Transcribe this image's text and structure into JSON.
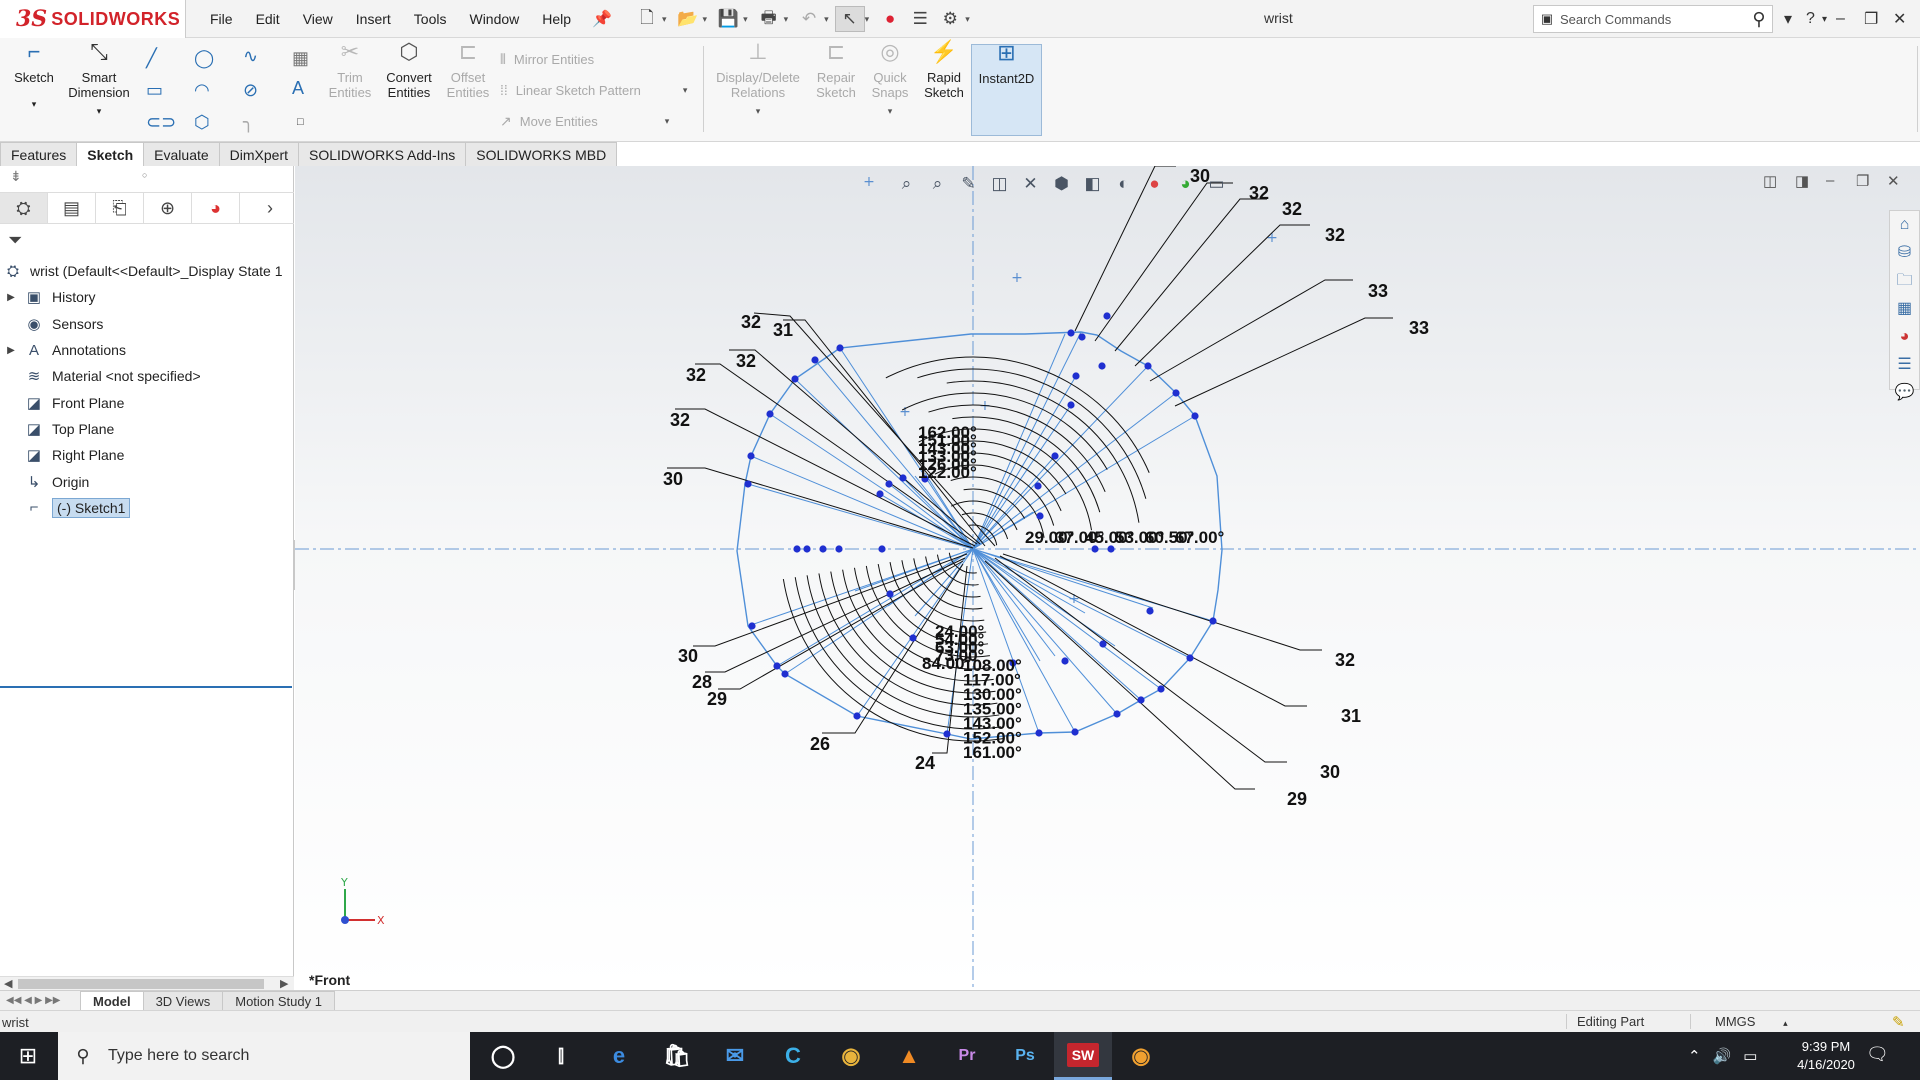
{
  "app": {
    "logo_mark": "3S",
    "logo_text": "SOLIDWORKS",
    "menus": [
      "File",
      "Edit",
      "View",
      "Insert",
      "Tools",
      "Window",
      "Help"
    ],
    "document_title": "wrist",
    "search_placeholder": "Search Commands"
  },
  "commands": {
    "sketch": "Sketch",
    "smart_dimension": [
      "Smart",
      "Dimension"
    ],
    "trim_entities": [
      "Trim",
      "Entities"
    ],
    "convert_entities": [
      "Convert",
      "Entities"
    ],
    "offset_entities": [
      "Offset",
      "Entities"
    ],
    "mirror_entities": "Mirror Entities",
    "linear_sketch_pattern": "Linear Sketch Pattern",
    "move_entities": "Move Entities",
    "display_delete_relations": [
      "Display/Delete",
      "Relations"
    ],
    "repair_sketch": [
      "Repair",
      "Sketch"
    ],
    "quick_snaps": [
      "Quick",
      "Snaps"
    ],
    "rapid_sketch": [
      "Rapid",
      "Sketch"
    ],
    "instant2d": "Instant2D"
  },
  "tabs": [
    {
      "label": "Features"
    },
    {
      "label": "Sketch",
      "active": true
    },
    {
      "label": "Evaluate"
    },
    {
      "label": "DimXpert"
    },
    {
      "label": "SOLIDWORKS Add-Ins"
    },
    {
      "label": "SOLIDWORKS MBD"
    }
  ],
  "tree": {
    "root": "wrist  (Default<<Default>_Display State 1",
    "items": [
      {
        "label": "History",
        "icon": "history-icon",
        "expandable": true
      },
      {
        "label": "Sensors",
        "icon": "sensors-icon",
        "expandable": false
      },
      {
        "label": "Annotations",
        "icon": "annotations-icon",
        "expandable": true
      },
      {
        "label": "Material <not specified>",
        "icon": "material-icon",
        "expandable": false
      },
      {
        "label": "Front Plane",
        "icon": "plane-icon",
        "expandable": false
      },
      {
        "label": "Top Plane",
        "icon": "plane-icon",
        "expandable": false
      },
      {
        "label": "Right Plane",
        "icon": "plane-icon",
        "expandable": false
      },
      {
        "label": "Origin",
        "icon": "origin-icon",
        "expandable": false
      },
      {
        "label": "(-) Sketch1",
        "icon": "sketch-icon",
        "expandable": false,
        "selected": true
      }
    ]
  },
  "viewport": {
    "view_name": "*Front",
    "triad": {
      "x_label": "X",
      "y_label": "Y"
    }
  },
  "sketch": {
    "spoke_labels": [
      "30",
      "32",
      "32",
      "32",
      "33",
      "33",
      "32",
      "31",
      "32",
      "32",
      "32",
      "30",
      "30",
      "28",
      "29",
      "26",
      "24",
      "29",
      "30",
      "31",
      "32"
    ],
    "angle_stack_upper": [
      "162.00°",
      "151.00°",
      "143.00°",
      "133.00°",
      "126.00°",
      "122.00°"
    ],
    "angle_row_right": [
      "29.00°",
      "37.00°",
      "45.00°",
      "53.00°",
      "60.50°",
      "67.00°"
    ],
    "angle_stack_left": [
      "24.00°",
      "54.00°",
      "63.00°",
      "73.00°",
      "84.00°"
    ],
    "angle_stack_lower": [
      "108.00°",
      "117.00°",
      "130.00°",
      "135.00°",
      "143.00°",
      "152.00°",
      "161.00°"
    ]
  },
  "bottom_tabs": [
    {
      "label": "Model",
      "active": true
    },
    {
      "label": "3D Views"
    },
    {
      "label": "Motion Study 1"
    }
  ],
  "status": {
    "left": "wrist",
    "mode": "Editing Part",
    "units": "MMGS"
  },
  "taskbar": {
    "search_placeholder": "Type here to search",
    "time": "9:39 PM",
    "date": "4/16/2020",
    "apps": [
      "task-view",
      "edge",
      "store",
      "mail",
      "cortana",
      "chrome",
      "vlc",
      "premiere",
      "photoshop",
      "solidworks",
      "chrome-canary"
    ]
  },
  "colors": {
    "brand_red": "#d2232a",
    "sketch_blue": "#4f8fd8",
    "point_blue": "#1f2fd0",
    "dimension_black": "#111111",
    "selection": "#c7dcf0"
  }
}
